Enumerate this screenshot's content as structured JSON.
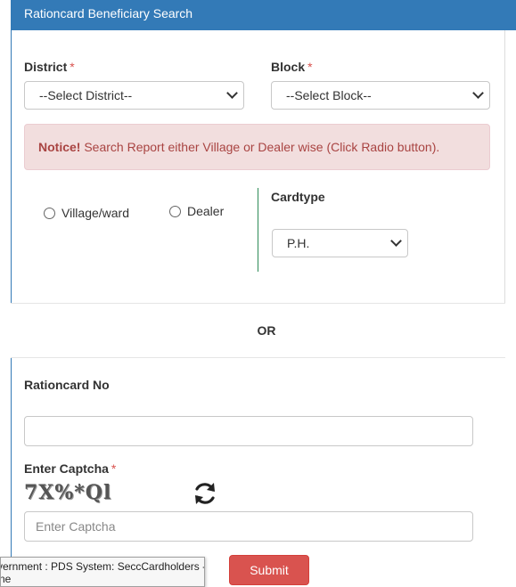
{
  "header": {
    "title": "Rationcard Beneficiary Search"
  },
  "district": {
    "label": "District",
    "required": "*",
    "selected": "--Select District--"
  },
  "block": {
    "label": "Block",
    "required": "*",
    "selected": "--Select Block--"
  },
  "notice": {
    "strong": "Notice!",
    "text": " Search Report either Village or Dealer wise (Click Radio button)."
  },
  "search_mode": {
    "options": [
      {
        "label": "Village/ward",
        "selected": false
      },
      {
        "label": "Dealer",
        "selected": false
      }
    ]
  },
  "cardtype": {
    "label": "Cardtype",
    "selected": "P.H."
  },
  "divider": {
    "text": "OR"
  },
  "rationcard": {
    "label": "Rationcard No",
    "value": "",
    "placeholder": ""
  },
  "captcha": {
    "label": "Enter Captcha",
    "required": "*",
    "image_text": "7X%*Ql",
    "placeholder": "Enter Captcha",
    "value": ""
  },
  "submit": {
    "label": "Submit"
  },
  "tooltip": {
    "line1": "vernment : PDS System: SeccCardholders -",
    "line2": "ne"
  },
  "colors": {
    "header": "#337ab7",
    "notice_bg": "#f2dede",
    "notice_text": "#a94442",
    "submit": "#d9534f",
    "required": "#d9534f"
  }
}
